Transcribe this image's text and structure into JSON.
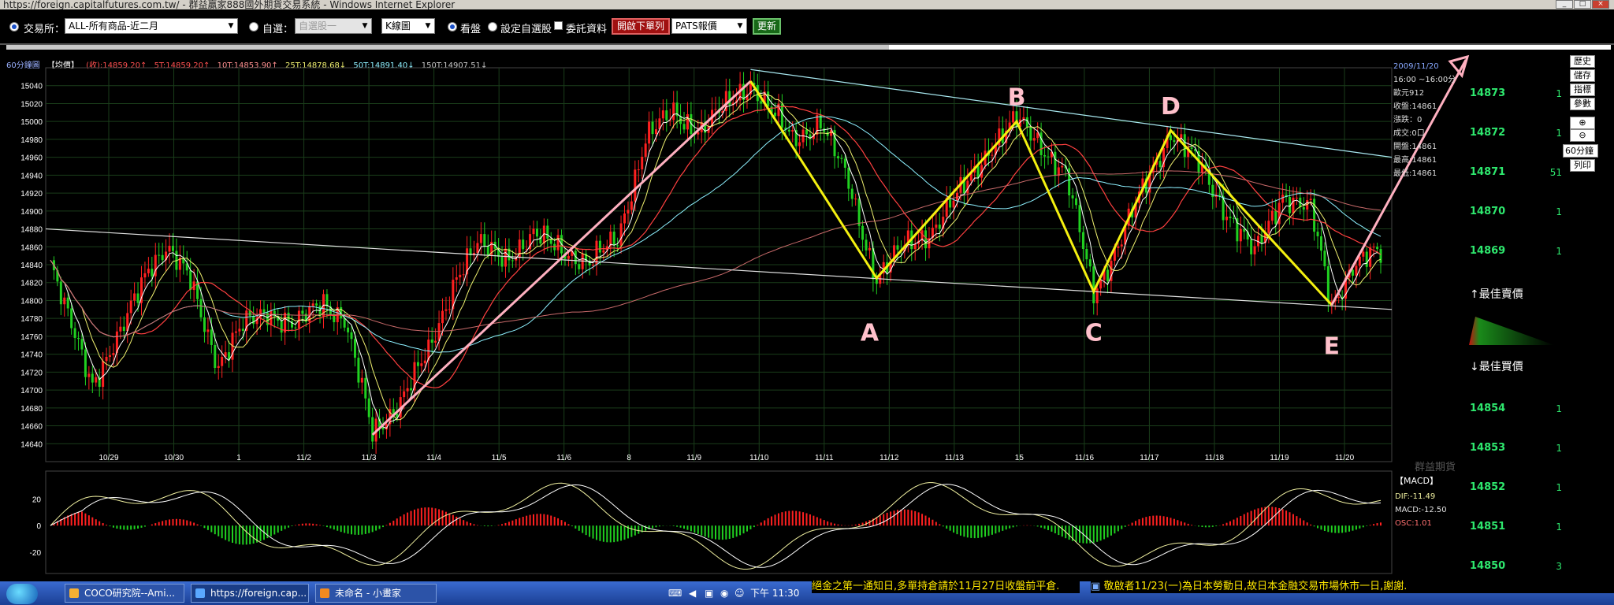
{
  "window": {
    "title": "https://foreign.capitalfutures.com.tw/ - 群益贏家888國外期貨交易系統 - Windows Internet Explorer"
  },
  "toolbar": {
    "exchange_label": "交易所：",
    "exchange_value": "ALL-所有商品-近二月",
    "watchlist_label": "自選：",
    "watchlist_value": "自選股一",
    "chart_type_value": "K線圖",
    "view_label": "看盤",
    "set_watchlist_label": "設定自選股",
    "orders_label": "委託資料",
    "open_order_button": "開啟下單列",
    "quote_source_value": "PATS報價",
    "refresh_button": "更新"
  },
  "chart_header": {
    "title": "60分鐘圖",
    "price_type": "【均價】",
    "close_label": "(收):14859.20↑",
    "ma": [
      "5T:14859.20↑",
      "10T:14853.90↑",
      "25T:14878.68↓",
      "50T:14891.40↓",
      "150T:14907.51↓"
    ]
  },
  "info_panel": {
    "date": "2009/11/20",
    "time": "16:00 ~16:00分",
    "items": [
      "歐元912",
      "收盤:14861",
      "漲跌：0",
      "成交:0口",
      "開盤:14861",
      "最高:14861",
      "最低:14861"
    ]
  },
  "side_buttons": [
    "歷史",
    "儲存",
    "指標",
    "參數"
  ],
  "interval_value": "60分鐘",
  "print_button": "列印",
  "order_book": {
    "prices": [
      "14873",
      "14872",
      "14871",
      "14870",
      "14869"
    ],
    "quantities": [
      "1",
      "1",
      "51",
      "1",
      "1"
    ],
    "best_sell": "↑最佳賣價",
    "best_buy": "↓最佳買價",
    "buy_prices": [
      "14854",
      "14853",
      "14852",
      "14851",
      "14850"
    ],
    "buy_quantities": [
      "1",
      "1",
      "1",
      "1",
      "3"
    ]
  },
  "macd": {
    "title": "【MACD】",
    "dif": "DIF:-11.49",
    "macd": "MACD:-12.50",
    "osc": "OSC:1.01",
    "ticks": [
      "20",
      "0",
      "-20"
    ]
  },
  "watermark": "群益期貨",
  "ticker": {
    "left": "絕金之第一通知日,多單持倉請於11月27日收盤前平倉.",
    "right": "敬啟者11/23(一)為日本勞動日,故日本金融交易市場休市一日,謝謝."
  },
  "taskbar": {
    "tasks": [
      "COCO研究院--Ami...",
      "https://foreign.cap...",
      "未命名 - 小畫家"
    ],
    "clock": "下午 11:30"
  },
  "chart_data": {
    "type": "candlestick",
    "interval": "60分鐘",
    "ylim": [
      14620,
      15060
    ],
    "y_ticks": [
      15040,
      15020,
      15000,
      14980,
      14960,
      14940,
      14920,
      14900,
      14880,
      14860,
      14840,
      14820,
      14800,
      14780,
      14760,
      14740,
      14720,
      14700,
      14680,
      14660,
      14640
    ],
    "x_labels": [
      "10/29",
      "10/30",
      "1",
      "11/2",
      "11/3",
      "11/4",
      "11/5",
      "11/6",
      "8",
      "11/9",
      "11/10",
      "11/11",
      "11/12",
      "11/13",
      "15",
      "11/16",
      "11/17",
      "11/18",
      "11/19",
      "11/20"
    ],
    "wave_path_prices": [
      14650,
      15045,
      14825,
      15000,
      14810,
      14990,
      14795
    ],
    "wave_labels": [
      "A",
      "B",
      "C",
      "D",
      "E"
    ],
    "wave_label_colors": [
      "#ffc0cb",
      "#ffc0cb",
      "#ffc0cb",
      "#ffc0cb",
      "#ffc0cb"
    ],
    "price_anchor_points": [
      [
        0,
        14840
      ],
      [
        4,
        14790
      ],
      [
        12,
        14710
      ],
      [
        20,
        14760
      ],
      [
        28,
        14840
      ],
      [
        33,
        14860
      ],
      [
        40,
        14820
      ],
      [
        48,
        14730
      ],
      [
        55,
        14770
      ],
      [
        62,
        14790
      ],
      [
        70,
        14770
      ],
      [
        78,
        14800
      ],
      [
        84,
        14780
      ],
      [
        92,
        14650
      ],
      [
        100,
        14690
      ],
      [
        108,
        14740
      ],
      [
        116,
        14830
      ],
      [
        122,
        14860
      ],
      [
        130,
        14850
      ],
      [
        138,
        14870
      ],
      [
        146,
        14860
      ],
      [
        154,
        14840
      ],
      [
        162,
        14870
      ],
      [
        170,
        14980
      ],
      [
        178,
        15010
      ],
      [
        186,
        14990
      ],
      [
        194,
        15020
      ],
      [
        200,
        15045
      ],
      [
        206,
        15010
      ],
      [
        212,
        14980
      ],
      [
        220,
        15000
      ],
      [
        228,
        14930
      ],
      [
        236,
        14825
      ],
      [
        244,
        14860
      ],
      [
        252,
        14880
      ],
      [
        260,
        14920
      ],
      [
        268,
        14970
      ],
      [
        276,
        15000
      ],
      [
        282,
        14980
      ],
      [
        290,
        14940
      ],
      [
        298,
        14810
      ],
      [
        306,
        14870
      ],
      [
        314,
        14940
      ],
      [
        320,
        14990
      ],
      [
        328,
        14950
      ],
      [
        336,
        14900
      ],
      [
        344,
        14850
      ],
      [
        352,
        14920
      ],
      [
        360,
        14900
      ],
      [
        366,
        14795
      ],
      [
        372,
        14840
      ],
      [
        378,
        14850
      ]
    ],
    "macd_ylim": [
      -35,
      40
    ]
  }
}
